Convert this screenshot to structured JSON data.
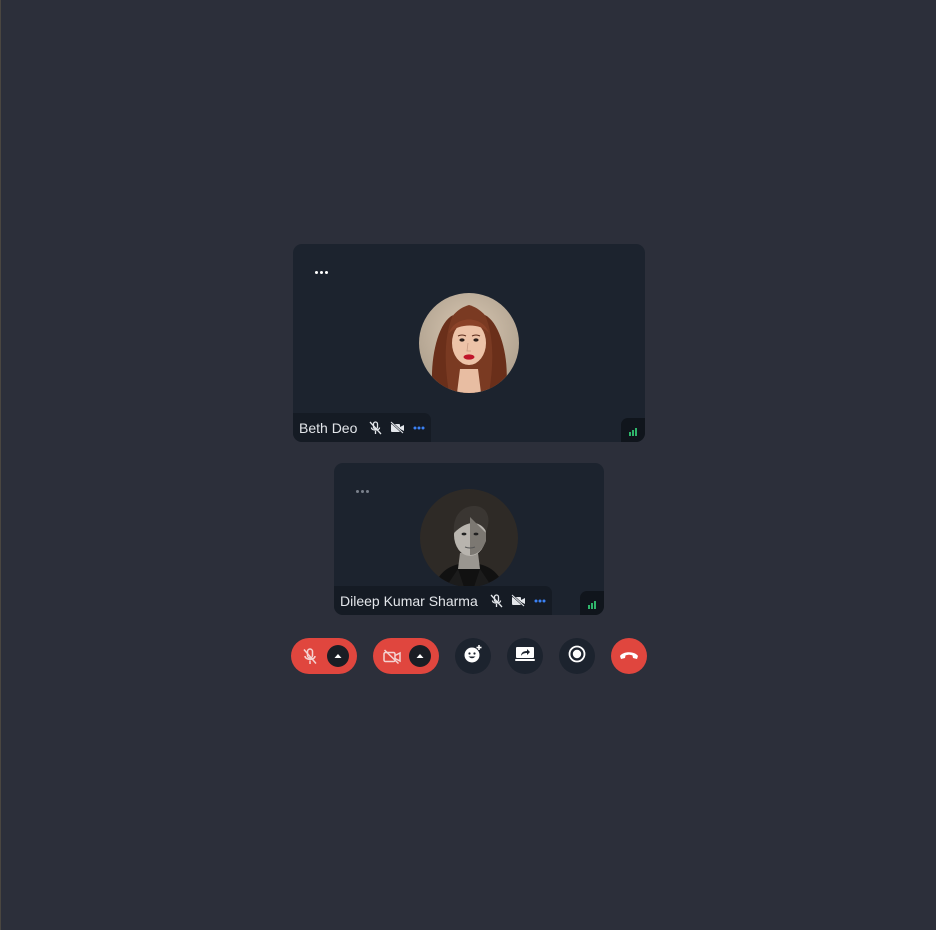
{
  "participants": [
    {
      "name": "Beth Deo",
      "avatar": "woman-portrait",
      "mic": "muted",
      "camera": "off",
      "more_icon": "more-dots-icon",
      "signal": "strong",
      "signal_color": "#2fb56b"
    },
    {
      "name": "Dileep Kumar Sharma",
      "avatar": "man-portrait-bw",
      "mic": "muted",
      "camera": "off",
      "more_icon": "more-dots-icon",
      "signal": "strong",
      "signal_color": "#2fb56b"
    }
  ],
  "controls": [
    {
      "name": "mic-toggle",
      "icon": "mic-off-icon",
      "state": "muted",
      "has_menu": true
    },
    {
      "name": "camera-toggle",
      "icon": "camera-off-icon",
      "state": "off",
      "has_menu": true
    },
    {
      "name": "reactions",
      "icon": "emoji-add-icon"
    },
    {
      "name": "screen-share",
      "icon": "screen-share-icon"
    },
    {
      "name": "record",
      "icon": "record-icon"
    },
    {
      "name": "leave-call",
      "icon": "hang-up-icon"
    }
  ],
  "colors": {
    "background": "#2c2f3a",
    "tile": "#1c232e",
    "danger": "#e0463e",
    "accent_dots": "#3b82f6"
  }
}
